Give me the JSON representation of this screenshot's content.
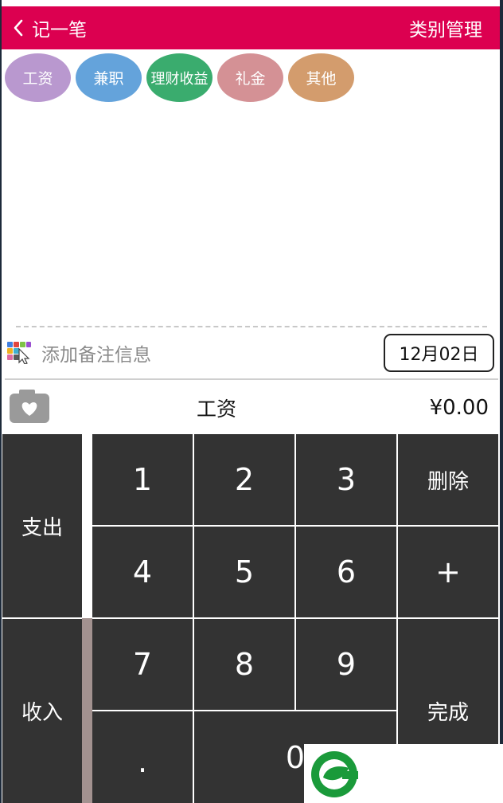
{
  "titlebar": {
    "back_label": "记一笔",
    "manage_label": "类别管理"
  },
  "categories": [
    {
      "label": "工资",
      "color": "#b998cf"
    },
    {
      "label": "兼职",
      "color": "#64a3db"
    },
    {
      "label": "理财收益",
      "color": "#3aac6e"
    },
    {
      "label": "礼金",
      "color": "#d49195"
    },
    {
      "label": "其他",
      "color": "#d39c6d"
    }
  ],
  "note": {
    "placeholder": "添加备注信息",
    "date": "12月02日"
  },
  "summary": {
    "category": "工资",
    "amount": "¥0.00"
  },
  "keypad": {
    "expense": "支出",
    "income": "收入",
    "k1": "1",
    "k2": "2",
    "k3": "3",
    "k4": "4",
    "k5": "5",
    "k6": "6",
    "k7": "7",
    "k8": "8",
    "k9": "9",
    "dot": ".",
    "zero": "0",
    "delete": "删除",
    "plus": "+",
    "done": "完成"
  },
  "colors": {
    "accent": "#dc0050",
    "keypad_bg": "#333333"
  }
}
